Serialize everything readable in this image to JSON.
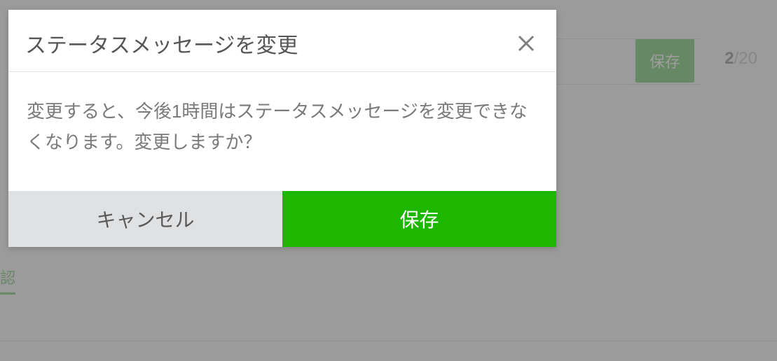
{
  "background": {
    "save_label": "保存",
    "counter_current": "2",
    "counter_max": "/20",
    "tab_label": "認"
  },
  "modal": {
    "title": "ステータスメッセージを変更",
    "message": "変更すると、今後1時間はステータスメッセージを変更できなくなります。変更しますか？",
    "cancel_label": "キャンセル",
    "save_label": "保存"
  }
}
